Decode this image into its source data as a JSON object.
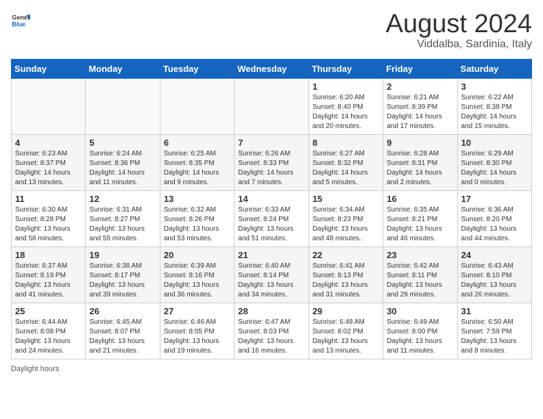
{
  "header": {
    "logo_general": "General",
    "logo_blue": "Blue",
    "title": "August 2024",
    "subtitle": "Viddalba, Sardinia, Italy"
  },
  "days_of_week": [
    "Sunday",
    "Monday",
    "Tuesday",
    "Wednesday",
    "Thursday",
    "Friday",
    "Saturday"
  ],
  "weeks": [
    [
      {
        "day": "",
        "sunrise": "",
        "sunset": "",
        "daylight": ""
      },
      {
        "day": "",
        "sunrise": "",
        "sunset": "",
        "daylight": ""
      },
      {
        "day": "",
        "sunrise": "",
        "sunset": "",
        "daylight": ""
      },
      {
        "day": "",
        "sunrise": "",
        "sunset": "",
        "daylight": ""
      },
      {
        "day": "1",
        "sunrise": "6:20 AM",
        "sunset": "8:40 PM",
        "daylight": "14 hours and 20 minutes."
      },
      {
        "day": "2",
        "sunrise": "6:21 AM",
        "sunset": "8:39 PM",
        "daylight": "14 hours and 17 minutes."
      },
      {
        "day": "3",
        "sunrise": "6:22 AM",
        "sunset": "8:38 PM",
        "daylight": "14 hours and 15 minutes."
      }
    ],
    [
      {
        "day": "4",
        "sunrise": "6:23 AM",
        "sunset": "8:37 PM",
        "daylight": "14 hours and 13 minutes."
      },
      {
        "day": "5",
        "sunrise": "6:24 AM",
        "sunset": "8:36 PM",
        "daylight": "14 hours and 11 minutes."
      },
      {
        "day": "6",
        "sunrise": "6:25 AM",
        "sunset": "8:35 PM",
        "daylight": "14 hours and 9 minutes."
      },
      {
        "day": "7",
        "sunrise": "6:26 AM",
        "sunset": "8:33 PM",
        "daylight": "14 hours and 7 minutes."
      },
      {
        "day": "8",
        "sunrise": "6:27 AM",
        "sunset": "8:32 PM",
        "daylight": "14 hours and 5 minutes."
      },
      {
        "day": "9",
        "sunrise": "6:28 AM",
        "sunset": "8:31 PM",
        "daylight": "14 hours and 2 minutes."
      },
      {
        "day": "10",
        "sunrise": "6:29 AM",
        "sunset": "8:30 PM",
        "daylight": "14 hours and 0 minutes."
      }
    ],
    [
      {
        "day": "11",
        "sunrise": "6:30 AM",
        "sunset": "8:28 PM",
        "daylight": "13 hours and 58 minutes."
      },
      {
        "day": "12",
        "sunrise": "6:31 AM",
        "sunset": "8:27 PM",
        "daylight": "13 hours and 55 minutes."
      },
      {
        "day": "13",
        "sunrise": "6:32 AM",
        "sunset": "8:26 PM",
        "daylight": "13 hours and 53 minutes."
      },
      {
        "day": "14",
        "sunrise": "6:33 AM",
        "sunset": "8:24 PM",
        "daylight": "13 hours and 51 minutes."
      },
      {
        "day": "15",
        "sunrise": "6:34 AM",
        "sunset": "8:23 PM",
        "daylight": "13 hours and 48 minutes."
      },
      {
        "day": "16",
        "sunrise": "6:35 AM",
        "sunset": "8:21 PM",
        "daylight": "13 hours and 46 minutes."
      },
      {
        "day": "17",
        "sunrise": "6:36 AM",
        "sunset": "8:20 PM",
        "daylight": "13 hours and 44 minutes."
      }
    ],
    [
      {
        "day": "18",
        "sunrise": "6:37 AM",
        "sunset": "8:19 PM",
        "daylight": "13 hours and 41 minutes."
      },
      {
        "day": "19",
        "sunrise": "6:38 AM",
        "sunset": "8:17 PM",
        "daylight": "13 hours and 39 minutes."
      },
      {
        "day": "20",
        "sunrise": "6:39 AM",
        "sunset": "8:16 PM",
        "daylight": "13 hours and 36 minutes."
      },
      {
        "day": "21",
        "sunrise": "6:40 AM",
        "sunset": "8:14 PM",
        "daylight": "13 hours and 34 minutes."
      },
      {
        "day": "22",
        "sunrise": "6:41 AM",
        "sunset": "8:13 PM",
        "daylight": "13 hours and 31 minutes."
      },
      {
        "day": "23",
        "sunrise": "6:42 AM",
        "sunset": "8:11 PM",
        "daylight": "13 hours and 29 minutes."
      },
      {
        "day": "24",
        "sunrise": "6:43 AM",
        "sunset": "8:10 PM",
        "daylight": "13 hours and 26 minutes."
      }
    ],
    [
      {
        "day": "25",
        "sunrise": "6:44 AM",
        "sunset": "8:08 PM",
        "daylight": "13 hours and 24 minutes."
      },
      {
        "day": "26",
        "sunrise": "6:45 AM",
        "sunset": "8:07 PM",
        "daylight": "13 hours and 21 minutes."
      },
      {
        "day": "27",
        "sunrise": "6:46 AM",
        "sunset": "8:05 PM",
        "daylight": "13 hours and 19 minutes."
      },
      {
        "day": "28",
        "sunrise": "6:47 AM",
        "sunset": "8:03 PM",
        "daylight": "13 hours and 16 minutes."
      },
      {
        "day": "29",
        "sunrise": "6:48 AM",
        "sunset": "8:02 PM",
        "daylight": "13 hours and 13 minutes."
      },
      {
        "day": "30",
        "sunrise": "6:49 AM",
        "sunset": "8:00 PM",
        "daylight": "13 hours and 11 minutes."
      },
      {
        "day": "31",
        "sunrise": "6:50 AM",
        "sunset": "7:59 PM",
        "daylight": "13 hours and 8 minutes."
      }
    ]
  ],
  "daylight_label": "Daylight hours"
}
